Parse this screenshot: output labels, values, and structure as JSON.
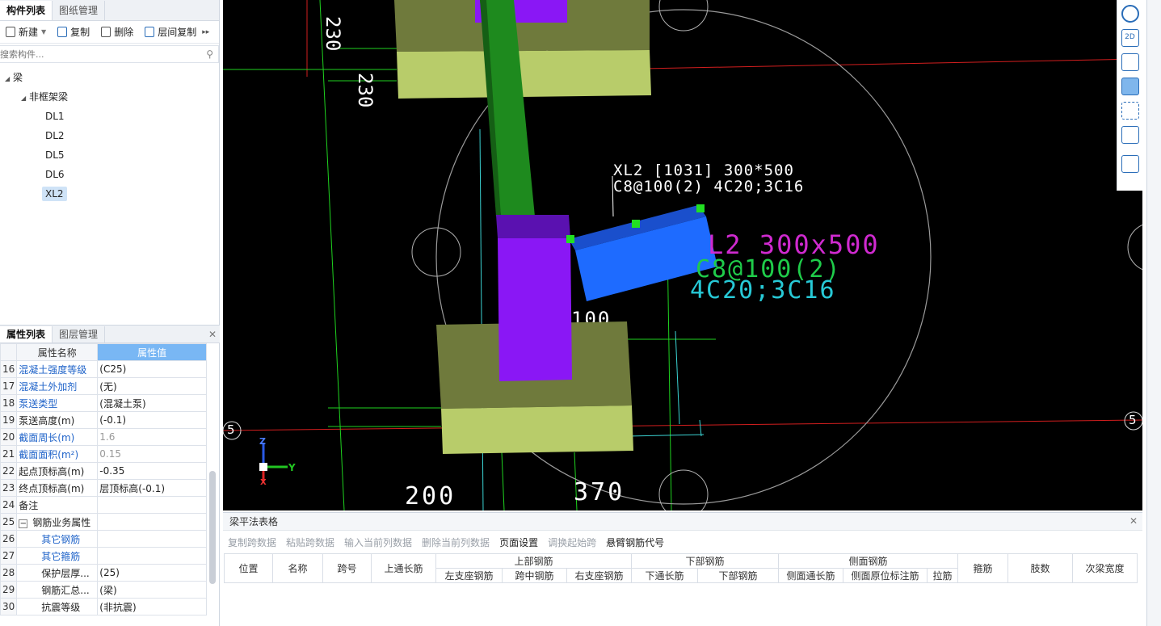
{
  "left_tabs": [
    "构件列表",
    "图纸管理"
  ],
  "toolbar": {
    "new": "新建",
    "copy": "复制",
    "delete": "删除",
    "floor_copy": "层间复制"
  },
  "search": {
    "placeholder": "搜索构件..."
  },
  "tree": {
    "root": "梁",
    "group": "非框架梁",
    "items": [
      "DL1",
      "DL2",
      "DL5",
      "DL6",
      "XL2"
    ],
    "selected": "XL2"
  },
  "props_tabs": [
    "属性列表",
    "图层管理"
  ],
  "props_headers": {
    "name": "属性名称",
    "value": "属性值"
  },
  "props": [
    {
      "no": "16",
      "name": "混凝土强度等级",
      "value": "(C25)"
    },
    {
      "no": "17",
      "name": "混凝土外加剂",
      "value": "(无)"
    },
    {
      "no": "18",
      "name": "泵送类型",
      "value": "(混凝土泵)"
    },
    {
      "no": "19",
      "name": "泵送高度(m)",
      "value": "(-0.1)"
    },
    {
      "no": "20",
      "name": "截面周长(m)",
      "value": "1.6"
    },
    {
      "no": "21",
      "name": "截面面积(m²)",
      "value": "0.15"
    },
    {
      "no": "22",
      "name": "起点顶标高(m)",
      "value": "-0.35"
    },
    {
      "no": "23",
      "name": "终点顶标高(m)",
      "value": "层顶标高(-0.1)"
    },
    {
      "no": "24",
      "name": "备注",
      "value": ""
    },
    {
      "no": "25",
      "name": "钢筋业务属性",
      "value": ""
    },
    {
      "no": "26",
      "name": "其它钢筋",
      "value": ""
    },
    {
      "no": "27",
      "name": "其它箍筋",
      "value": ""
    },
    {
      "no": "28",
      "name": "保护层厚...",
      "value": "(25)"
    },
    {
      "no": "29",
      "name": "钢筋汇总...",
      "value": "(梁)"
    },
    {
      "no": "30",
      "name": "抗震等级",
      "value": "(非抗震)"
    }
  ],
  "props_collapse_sign": "−",
  "canvas": {
    "label_white_1": "XL2 [1031] 300*500",
    "label_white_2": "C8@100(2) 4C20;3C16",
    "label_magenta": "L2 300x500",
    "label_green": "C8@100(2)",
    "label_cyan": "4C20;3C16",
    "axis_left": "5",
    "axis_right": "5",
    "dim_bottom_1": "200",
    "dim_bottom_2": "370",
    "dim_mid": "100",
    "dim_top_1": "230",
    "dim_top_2": "230",
    "axis_z": "Z",
    "axis_y": "Y",
    "axis_x": "X"
  },
  "bottom": {
    "title": "梁平法表格",
    "tools": [
      {
        "label": "复制跨数据",
        "enabled": false
      },
      {
        "label": "粘贴跨数据",
        "enabled": false
      },
      {
        "label": "输入当前列数据",
        "enabled": false
      },
      {
        "label": "删除当前列数据",
        "enabled": false
      },
      {
        "label": "页面设置",
        "enabled": true
      },
      {
        "label": "调换起始跨",
        "enabled": false
      },
      {
        "label": "悬臂钢筋代号",
        "enabled": true
      }
    ],
    "headers_top": [
      "位置",
      "名称",
      "跨号",
      "上通长筋",
      "上部钢筋",
      "下部钢筋",
      "侧面钢筋",
      "箍筋",
      "肢数",
      "次梁宽度"
    ],
    "headers_sub": [
      "左支座钢筋",
      "跨中钢筋",
      "右支座钢筋",
      "下通长筋",
      "下部钢筋",
      "侧面通长筋",
      "侧面原位标注筋",
      "拉筋"
    ]
  },
  "right_tools": [
    "2D"
  ],
  "colors": {
    "accent": "#79b7f4",
    "beam_blue": "#1e6bff",
    "column_purple": "#8a17f5",
    "green_beam": "#1e8a1e",
    "footing": "#b8cc6a"
  }
}
